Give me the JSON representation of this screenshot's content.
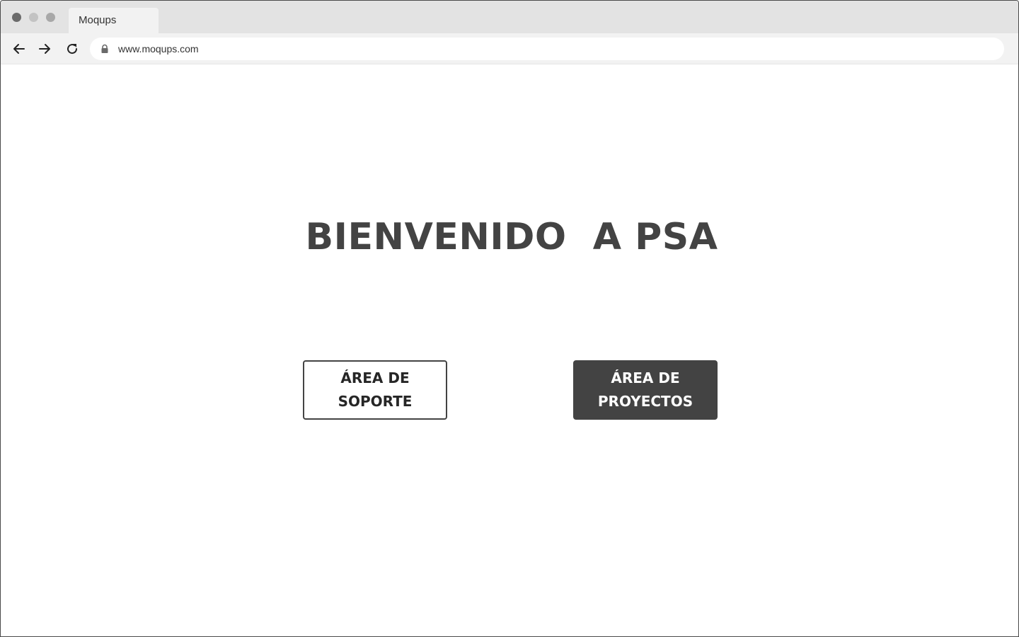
{
  "browser": {
    "tab_title": "Moqups",
    "url": "www.moqups.com"
  },
  "page": {
    "headline": "BIENVENIDO  A PSA",
    "buttons": {
      "support_label": "ÁREA DE SOPORTE",
      "projects_label": "ÁREA DE PROYECTOS"
    }
  },
  "icons": {
    "back": "arrow-left-icon",
    "forward": "arrow-right-icon",
    "reload": "reload-icon",
    "lock": "lock-icon"
  },
  "colors": {
    "primary_dark": "#434343",
    "chrome_bg": "#e3e3e3",
    "toolbar_bg": "#f2f2f2"
  }
}
